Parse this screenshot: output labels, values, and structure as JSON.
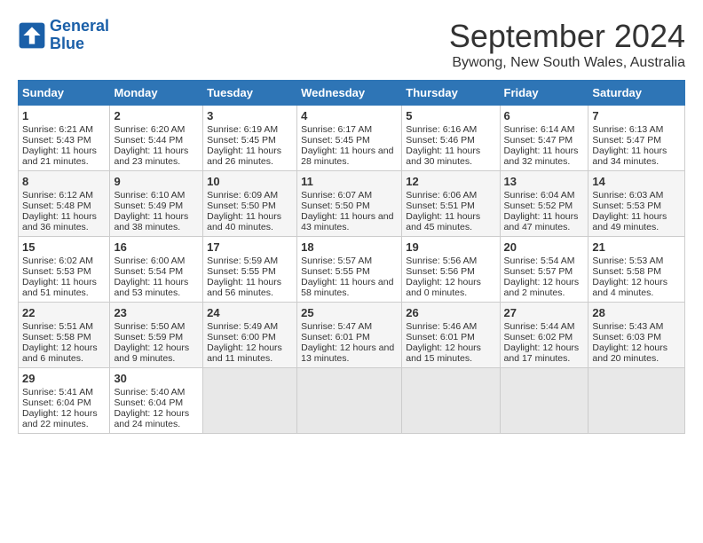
{
  "header": {
    "logo_line1": "General",
    "logo_line2": "Blue",
    "title": "September 2024",
    "subtitle": "Bywong, New South Wales, Australia"
  },
  "days_of_week": [
    "Sunday",
    "Monday",
    "Tuesday",
    "Wednesday",
    "Thursday",
    "Friday",
    "Saturday"
  ],
  "weeks": [
    [
      {
        "day": "1",
        "sunrise": "6:21 AM",
        "sunset": "5:43 PM",
        "daylight": "11 hours and 21 minutes."
      },
      {
        "day": "2",
        "sunrise": "6:20 AM",
        "sunset": "5:44 PM",
        "daylight": "11 hours and 23 minutes."
      },
      {
        "day": "3",
        "sunrise": "6:19 AM",
        "sunset": "5:45 PM",
        "daylight": "11 hours and 26 minutes."
      },
      {
        "day": "4",
        "sunrise": "6:17 AM",
        "sunset": "5:45 PM",
        "daylight": "11 hours and 28 minutes."
      },
      {
        "day": "5",
        "sunrise": "6:16 AM",
        "sunset": "5:46 PM",
        "daylight": "11 hours and 30 minutes."
      },
      {
        "day": "6",
        "sunrise": "6:14 AM",
        "sunset": "5:47 PM",
        "daylight": "11 hours and 32 minutes."
      },
      {
        "day": "7",
        "sunrise": "6:13 AM",
        "sunset": "5:47 PM",
        "daylight": "11 hours and 34 minutes."
      }
    ],
    [
      {
        "day": "8",
        "sunrise": "6:12 AM",
        "sunset": "5:48 PM",
        "daylight": "11 hours and 36 minutes."
      },
      {
        "day": "9",
        "sunrise": "6:10 AM",
        "sunset": "5:49 PM",
        "daylight": "11 hours and 38 minutes."
      },
      {
        "day": "10",
        "sunrise": "6:09 AM",
        "sunset": "5:50 PM",
        "daylight": "11 hours and 40 minutes."
      },
      {
        "day": "11",
        "sunrise": "6:07 AM",
        "sunset": "5:50 PM",
        "daylight": "11 hours and 43 minutes."
      },
      {
        "day": "12",
        "sunrise": "6:06 AM",
        "sunset": "5:51 PM",
        "daylight": "11 hours and 45 minutes."
      },
      {
        "day": "13",
        "sunrise": "6:04 AM",
        "sunset": "5:52 PM",
        "daylight": "11 hours and 47 minutes."
      },
      {
        "day": "14",
        "sunrise": "6:03 AM",
        "sunset": "5:53 PM",
        "daylight": "11 hours and 49 minutes."
      }
    ],
    [
      {
        "day": "15",
        "sunrise": "6:02 AM",
        "sunset": "5:53 PM",
        "daylight": "11 hours and 51 minutes."
      },
      {
        "day": "16",
        "sunrise": "6:00 AM",
        "sunset": "5:54 PM",
        "daylight": "11 hours and 53 minutes."
      },
      {
        "day": "17",
        "sunrise": "5:59 AM",
        "sunset": "5:55 PM",
        "daylight": "11 hours and 56 minutes."
      },
      {
        "day": "18",
        "sunrise": "5:57 AM",
        "sunset": "5:55 PM",
        "daylight": "11 hours and 58 minutes."
      },
      {
        "day": "19",
        "sunrise": "5:56 AM",
        "sunset": "5:56 PM",
        "daylight": "12 hours and 0 minutes."
      },
      {
        "day": "20",
        "sunrise": "5:54 AM",
        "sunset": "5:57 PM",
        "daylight": "12 hours and 2 minutes."
      },
      {
        "day": "21",
        "sunrise": "5:53 AM",
        "sunset": "5:58 PM",
        "daylight": "12 hours and 4 minutes."
      }
    ],
    [
      {
        "day": "22",
        "sunrise": "5:51 AM",
        "sunset": "5:58 PM",
        "daylight": "12 hours and 6 minutes."
      },
      {
        "day": "23",
        "sunrise": "5:50 AM",
        "sunset": "5:59 PM",
        "daylight": "12 hours and 9 minutes."
      },
      {
        "day": "24",
        "sunrise": "5:49 AM",
        "sunset": "6:00 PM",
        "daylight": "12 hours and 11 minutes."
      },
      {
        "day": "25",
        "sunrise": "5:47 AM",
        "sunset": "6:01 PM",
        "daylight": "12 hours and 13 minutes."
      },
      {
        "day": "26",
        "sunrise": "5:46 AM",
        "sunset": "6:01 PM",
        "daylight": "12 hours and 15 minutes."
      },
      {
        "day": "27",
        "sunrise": "5:44 AM",
        "sunset": "6:02 PM",
        "daylight": "12 hours and 17 minutes."
      },
      {
        "day": "28",
        "sunrise": "5:43 AM",
        "sunset": "6:03 PM",
        "daylight": "12 hours and 20 minutes."
      }
    ],
    [
      {
        "day": "29",
        "sunrise": "5:41 AM",
        "sunset": "6:04 PM",
        "daylight": "12 hours and 22 minutes."
      },
      {
        "day": "30",
        "sunrise": "5:40 AM",
        "sunset": "6:04 PM",
        "daylight": "12 hours and 24 minutes."
      },
      null,
      null,
      null,
      null,
      null
    ]
  ]
}
